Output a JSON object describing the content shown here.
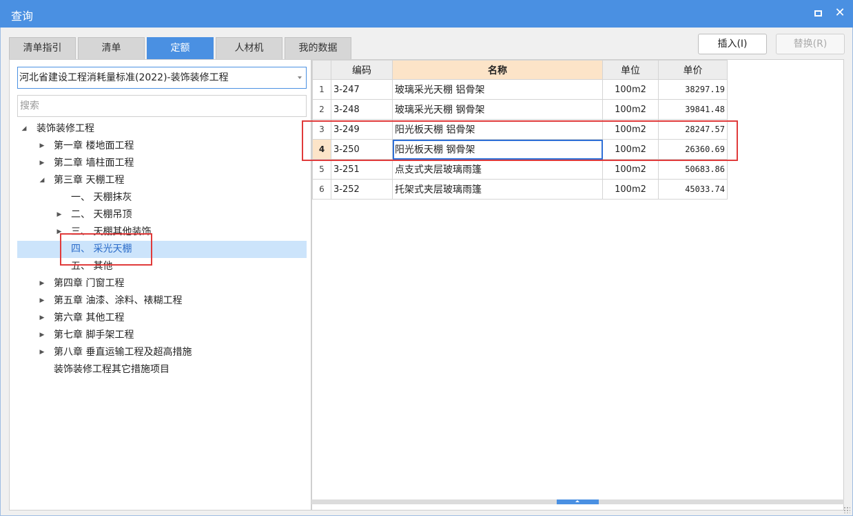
{
  "window": {
    "title": "查询"
  },
  "tabs": [
    {
      "label": "清单指引",
      "active": false
    },
    {
      "label": "清单",
      "active": false
    },
    {
      "label": "定额",
      "active": true
    },
    {
      "label": "人材机",
      "active": false
    },
    {
      "label": "我的数据",
      "active": false
    }
  ],
  "toolbar": {
    "insert_label": "插入(I)",
    "replace_label": "替换(R)"
  },
  "library": {
    "selected": "河北省建设工程消耗量标准(2022)-装饰装修工程"
  },
  "search": {
    "placeholder": "搜索"
  },
  "tree": [
    {
      "label": "装饰装修工程",
      "expanded": true
    },
    {
      "label": "第一章 楼地面工程",
      "expanded": false
    },
    {
      "label": "第二章 墙柱面工程",
      "expanded": false
    },
    {
      "label": "第三章 天棚工程",
      "expanded": true
    },
    {
      "label": "一、 天棚抹灰"
    },
    {
      "label": "二、 天棚吊顶",
      "expanded": false
    },
    {
      "label": "三、 天棚其他装饰",
      "expanded": false
    },
    {
      "label": "四、 采光天棚",
      "selected": true
    },
    {
      "label": "五、 其他"
    },
    {
      "label": "第四章 门窗工程",
      "expanded": false
    },
    {
      "label": "第五章 油漆、涂料、裱糊工程",
      "expanded": false
    },
    {
      "label": "第六章 其他工程",
      "expanded": false
    },
    {
      "label": "第七章 脚手架工程",
      "expanded": false
    },
    {
      "label": "第八章 垂直运输工程及超高措施",
      "expanded": false
    },
    {
      "label": "装饰装修工程其它措施项目"
    }
  ],
  "grid": {
    "headers": {
      "code": "编码",
      "name": "名称",
      "unit": "单位",
      "price": "单价"
    },
    "rows": [
      {
        "idx": "1",
        "code": "3-247",
        "name": "玻璃采光天棚 铝骨架",
        "unit": "100m2",
        "price": "38297.19"
      },
      {
        "idx": "2",
        "code": "3-248",
        "name": "玻璃采光天棚 钢骨架",
        "unit": "100m2",
        "price": "39841.48"
      },
      {
        "idx": "3",
        "code": "3-249",
        "name": "阳光板天棚 铝骨架",
        "unit": "100m2",
        "price": "28247.57"
      },
      {
        "idx": "4",
        "code": "3-250",
        "name": "阳光板天棚 钢骨架",
        "unit": "100m2",
        "price": "26360.69"
      },
      {
        "idx": "5",
        "code": "3-251",
        "name": "点支式夹层玻璃雨篷",
        "unit": "100m2",
        "price": "50683.86"
      },
      {
        "idx": "6",
        "code": "3-252",
        "name": "托架式夹层玻璃雨篷",
        "unit": "100m2",
        "price": "45033.74"
      }
    ],
    "current_row": 4
  },
  "colors": {
    "accent": "#4a90e2",
    "highlight": "#e03a3a",
    "header_highlight": "#fce4c8",
    "selection": "#cce4fb"
  }
}
